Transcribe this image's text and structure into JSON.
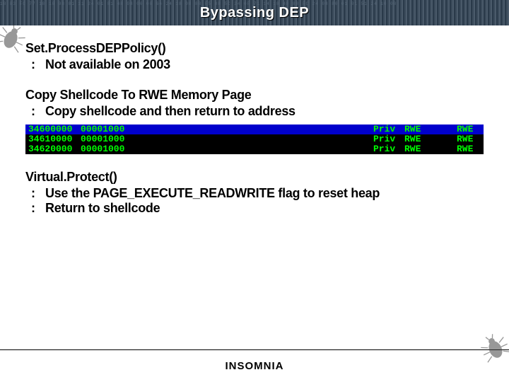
{
  "header": {
    "title": "Bypassing DEP"
  },
  "sections": [
    {
      "title": "Set.ProcessDEPPolicy()",
      "bullets": [
        "Not available on 2003"
      ]
    },
    {
      "title": "Copy Shellcode To RWE Memory Page",
      "bullets": [
        "Copy shellcode and then return to address"
      ]
    },
    {
      "title": "Virtual.Protect()",
      "bullets": [
        "Use the PAGE_EXECUTE_READWRITE flag to reset heap",
        "Return to shellcode"
      ]
    }
  ],
  "memtable": {
    "rows": [
      {
        "addr": "34600000",
        "val": "00001000",
        "priv": "Priv",
        "perm1": "RWE",
        "perm2": "RWE",
        "selected": true
      },
      {
        "addr": "34610000",
        "val": "00001000",
        "priv": "Priv",
        "perm1": "RWE",
        "perm2": "RWE",
        "selected": false
      },
      {
        "addr": "34620000",
        "val": "00001000",
        "priv": "Priv",
        "perm1": "RWE",
        "perm2": "RWE",
        "selected": false
      }
    ]
  },
  "footer": {
    "brand": "INSOMNIA"
  },
  "bullet_marker": ":"
}
